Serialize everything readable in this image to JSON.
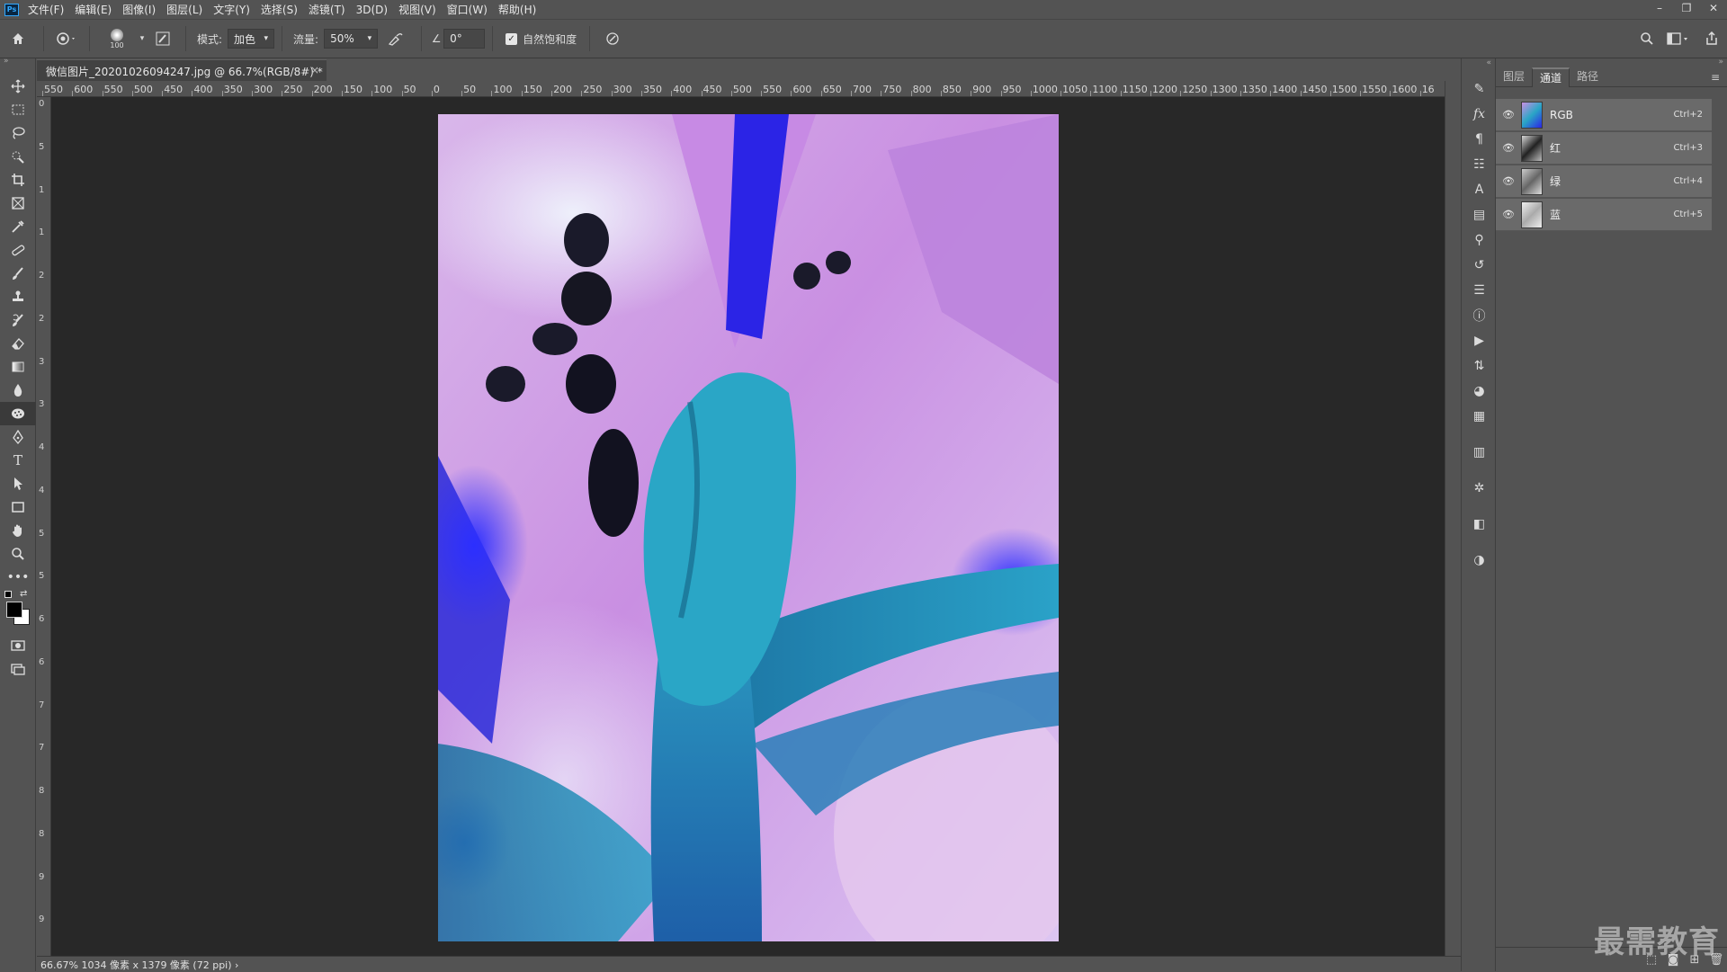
{
  "app": {
    "logo": "Ps",
    "menus": [
      "文件(F)",
      "编辑(E)",
      "图像(I)",
      "图层(L)",
      "文字(Y)",
      "选择(S)",
      "滤镜(T)",
      "3D(D)",
      "视图(V)",
      "窗口(W)",
      "帮助(H)"
    ],
    "window_controls": [
      "–",
      "❐",
      "✕"
    ]
  },
  "options": {
    "brush_size": "100",
    "mode_label": "模式:",
    "mode_value": "加色",
    "flow_label": "流量:",
    "flow_value": "50%",
    "angle_value": "0°",
    "vibrance_label": "自然饱和度",
    "vibrance_checked": true
  },
  "document": {
    "tab_title": "微信图片_20201026094247.jpg @ 66.7%(RGB/8#) *",
    "tab_close": "×"
  },
  "ruler_top": [
    "550",
    "600",
    "550",
    "500",
    "450",
    "400",
    "350",
    "300",
    "250",
    "200",
    "150",
    "100",
    "50",
    "0",
    "50",
    "100",
    "150",
    "200",
    "250",
    "300",
    "350",
    "400",
    "450",
    "500",
    "550",
    "600",
    "650",
    "700",
    "750",
    "800",
    "850",
    "900",
    "950",
    "1000",
    "1050",
    "1100",
    "1150",
    "1200",
    "1250",
    "1300",
    "1350",
    "1400",
    "1450",
    "1500",
    "1550",
    "1600",
    "16"
  ],
  "ruler_left": [
    "0",
    "5",
    "1",
    "1",
    "2",
    "2",
    "3",
    "3",
    "4",
    "4",
    "5",
    "5",
    "6",
    "6",
    "7",
    "7",
    "8",
    "8",
    "9",
    "9"
  ],
  "status": {
    "zoom": "66.67%",
    "info": "1034 像素 x 1379 像素 (72 ppi)",
    "arrow": "›"
  },
  "panel": {
    "tabs": [
      "图层",
      "通道",
      "路径"
    ],
    "active_tab": 1,
    "channels": [
      {
        "name": "RGB",
        "shortcut": "Ctrl+2"
      },
      {
        "name": "红",
        "shortcut": "Ctrl+3"
      },
      {
        "name": "绿",
        "shortcut": "Ctrl+4"
      },
      {
        "name": "蓝",
        "shortcut": "Ctrl+5"
      }
    ]
  },
  "watermark": "最需教育",
  "colors": {
    "accent": "#31a8ff",
    "canvas_bg": "#282828",
    "ui_bg": "#535353"
  }
}
